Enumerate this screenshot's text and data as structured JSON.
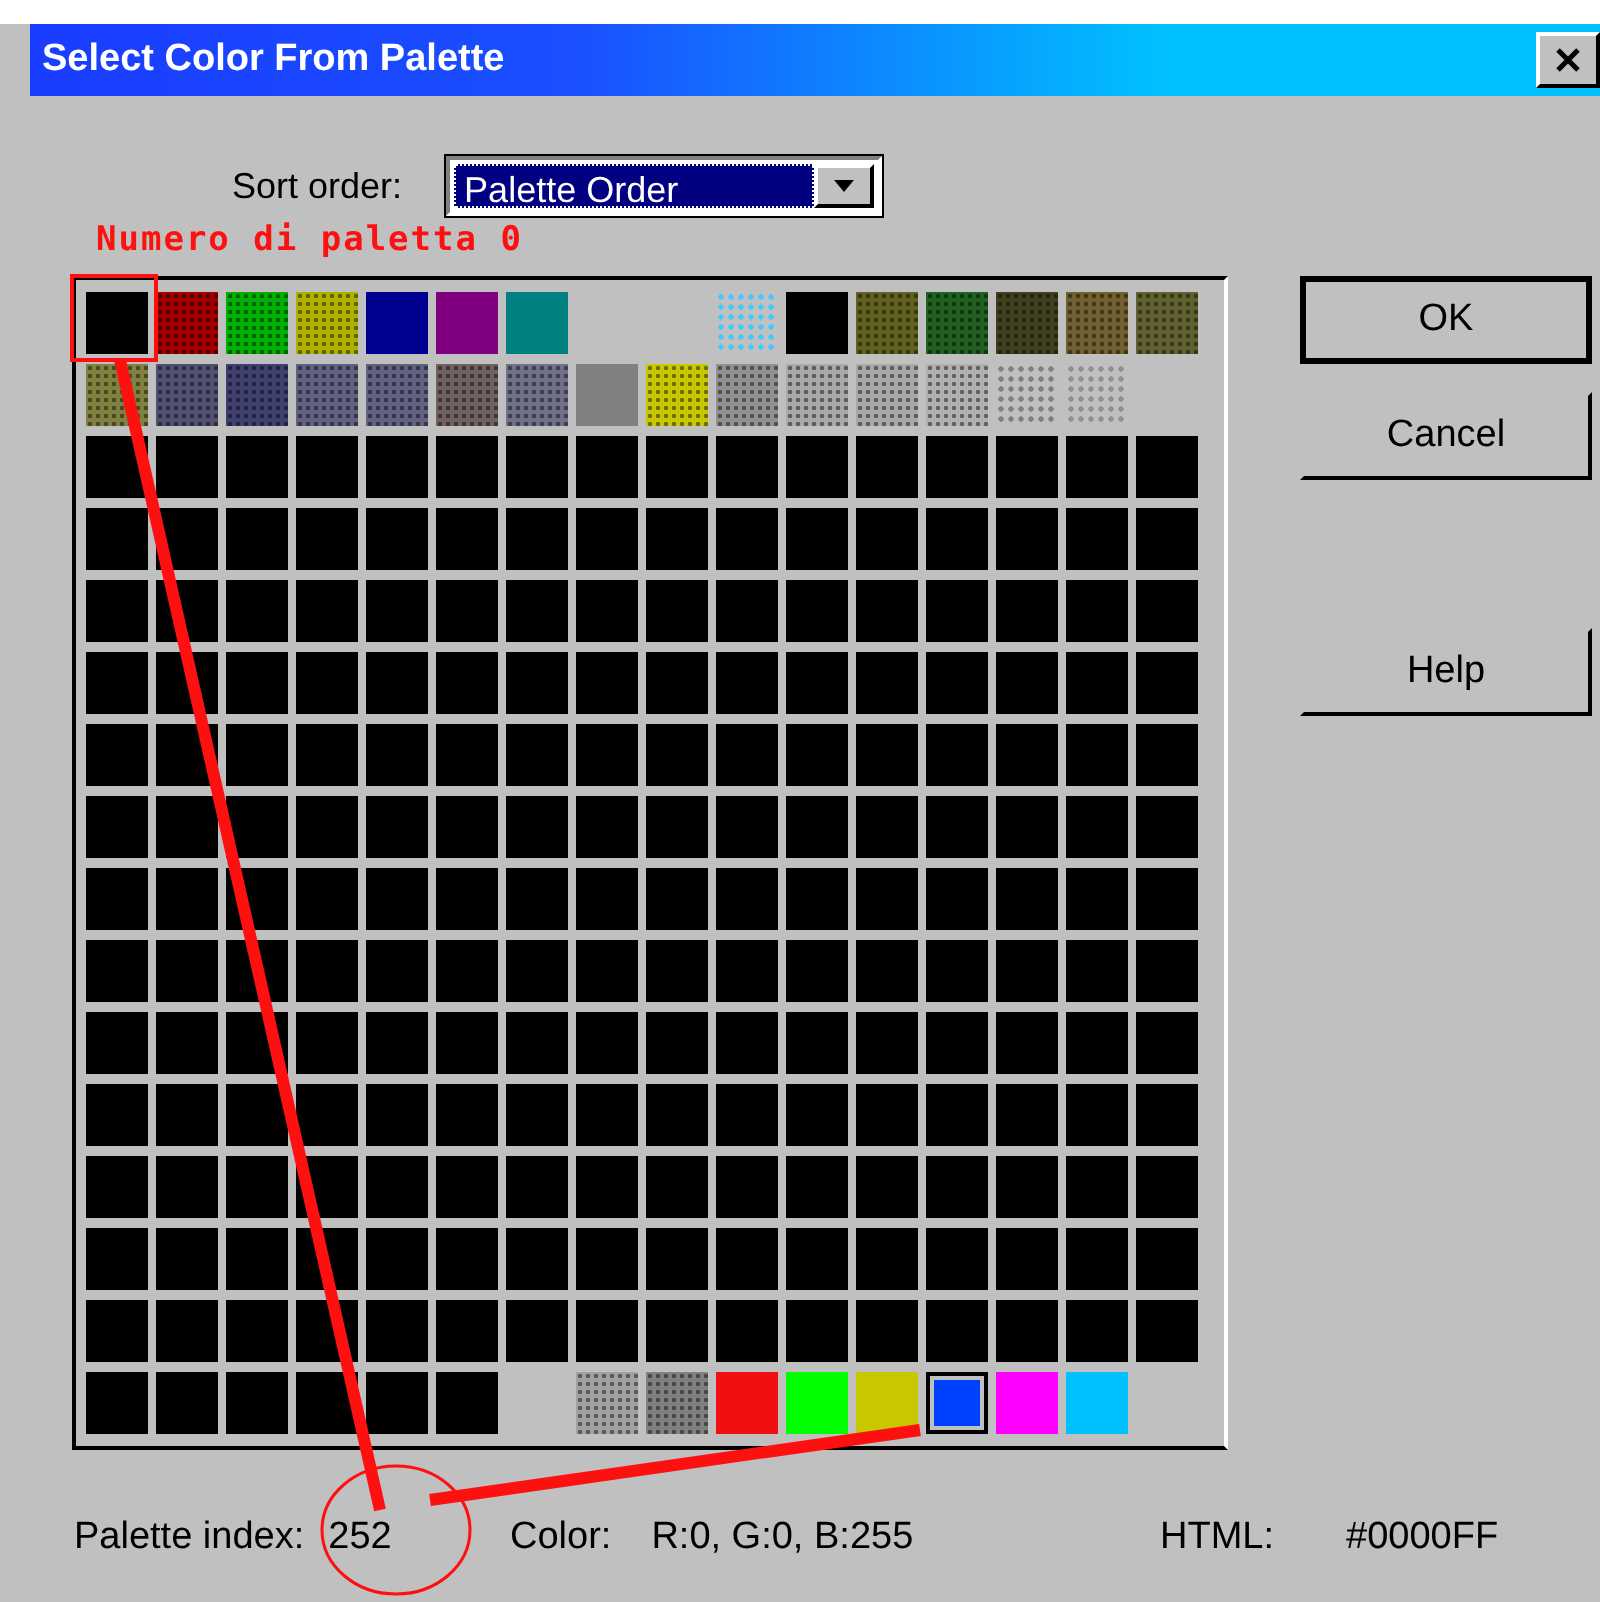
{
  "window": {
    "title": "Select Color From Palette"
  },
  "sort": {
    "label": "Sort order:",
    "value": "Palette Order"
  },
  "annotation": {
    "note": "Numero di paletta 0"
  },
  "palette": {
    "rows": [
      {
        "cells": [
          {
            "kind": "solid",
            "color": "#000000",
            "selected": false
          },
          {
            "kind": "dither",
            "color": "#a00000",
            "selected": false
          },
          {
            "kind": "dither",
            "color": "#00b000",
            "selected": false
          },
          {
            "kind": "dither",
            "color": "#b0b000",
            "selected": false
          },
          {
            "kind": "solid",
            "color": "#000090",
            "selected": false
          },
          {
            "kind": "solid",
            "color": "#800080",
            "selected": false
          },
          {
            "kind": "solid",
            "color": "#008080",
            "selected": false
          },
          {
            "kind": "empty"
          },
          {
            "kind": "empty"
          },
          {
            "kind": "dots",
            "color": "#40c8ff",
            "selected": false
          },
          {
            "kind": "solid",
            "color": "#000000",
            "selected": false
          },
          {
            "kind": "dither",
            "color": "#606020",
            "selected": false
          },
          {
            "kind": "dither",
            "color": "#206020",
            "selected": false
          },
          {
            "kind": "dither",
            "color": "#404020",
            "selected": false
          },
          {
            "kind": "dither",
            "color": "#706030",
            "selected": false
          },
          {
            "kind": "dither",
            "color": "#606030",
            "selected": false
          }
        ]
      },
      {
        "cells": [
          {
            "kind": "dither",
            "color": "#808040",
            "selected": false
          },
          {
            "kind": "dither",
            "color": "#505070",
            "selected": false
          },
          {
            "kind": "dither",
            "color": "#404070",
            "selected": false
          },
          {
            "kind": "dither",
            "color": "#606080",
            "selected": false
          },
          {
            "kind": "dither",
            "color": "#606080",
            "selected": false
          },
          {
            "kind": "dither",
            "color": "#706060",
            "selected": false
          },
          {
            "kind": "dither",
            "color": "#707088",
            "selected": false
          },
          {
            "kind": "solid",
            "color": "#808080",
            "selected": false
          },
          {
            "kind": "dither",
            "color": "#c8c800",
            "selected": false
          },
          {
            "kind": "dither",
            "color": "#909090",
            "selected": false
          },
          {
            "kind": "dither",
            "color": "#a8a8a8",
            "selected": false
          },
          {
            "kind": "dither",
            "color": "#a8a8a8",
            "selected": false
          },
          {
            "kind": "dither",
            "color": "#b0b0b0",
            "selected": false
          },
          {
            "kind": "dots",
            "color": "#808080",
            "selected": false
          },
          {
            "kind": "dots",
            "color": "#909090",
            "selected": false
          },
          {
            "kind": "empty"
          }
        ]
      },
      {
        "cells": [
          {
            "kind": "solid",
            "color": "#000000",
            "selected": false
          },
          {
            "kind": "solid",
            "color": "#000000",
            "selected": false
          },
          {
            "kind": "solid",
            "color": "#000000",
            "selected": false
          },
          {
            "kind": "solid",
            "color": "#000000",
            "selected": false
          },
          {
            "kind": "solid",
            "color": "#000000",
            "selected": false
          },
          {
            "kind": "solid",
            "color": "#000000",
            "selected": false
          },
          {
            "kind": "solid",
            "color": "#000000",
            "selected": false
          },
          {
            "kind": "solid",
            "color": "#000000",
            "selected": false
          },
          {
            "kind": "solid",
            "color": "#000000",
            "selected": false
          },
          {
            "kind": "solid",
            "color": "#000000",
            "selected": false
          },
          {
            "kind": "solid",
            "color": "#000000",
            "selected": false
          },
          {
            "kind": "solid",
            "color": "#000000",
            "selected": false
          },
          {
            "kind": "solid",
            "color": "#000000",
            "selected": false
          },
          {
            "kind": "solid",
            "color": "#000000",
            "selected": false
          },
          {
            "kind": "solid",
            "color": "#000000",
            "selected": false
          },
          {
            "kind": "solid",
            "color": "#000000",
            "selected": false
          }
        ]
      },
      {
        "cells": [
          {
            "kind": "solid",
            "color": "#000000",
            "selected": false
          },
          {
            "kind": "solid",
            "color": "#000000",
            "selected": false
          },
          {
            "kind": "solid",
            "color": "#000000",
            "selected": false
          },
          {
            "kind": "solid",
            "color": "#000000",
            "selected": false
          },
          {
            "kind": "solid",
            "color": "#000000",
            "selected": false
          },
          {
            "kind": "solid",
            "color": "#000000",
            "selected": false
          },
          {
            "kind": "solid",
            "color": "#000000",
            "selected": false
          },
          {
            "kind": "solid",
            "color": "#000000",
            "selected": false
          },
          {
            "kind": "solid",
            "color": "#000000",
            "selected": false
          },
          {
            "kind": "solid",
            "color": "#000000",
            "selected": false
          },
          {
            "kind": "solid",
            "color": "#000000",
            "selected": false
          },
          {
            "kind": "solid",
            "color": "#000000",
            "selected": false
          },
          {
            "kind": "solid",
            "color": "#000000",
            "selected": false
          },
          {
            "kind": "solid",
            "color": "#000000",
            "selected": false
          },
          {
            "kind": "solid",
            "color": "#000000",
            "selected": false
          },
          {
            "kind": "solid",
            "color": "#000000",
            "selected": false
          }
        ]
      },
      {
        "cells": [
          {
            "kind": "solid",
            "color": "#000000",
            "selected": false
          },
          {
            "kind": "solid",
            "color": "#000000",
            "selected": false
          },
          {
            "kind": "solid",
            "color": "#000000",
            "selected": false
          },
          {
            "kind": "solid",
            "color": "#000000",
            "selected": false
          },
          {
            "kind": "solid",
            "color": "#000000",
            "selected": false
          },
          {
            "kind": "solid",
            "color": "#000000",
            "selected": false
          },
          {
            "kind": "solid",
            "color": "#000000",
            "selected": false
          },
          {
            "kind": "solid",
            "color": "#000000",
            "selected": false
          },
          {
            "kind": "solid",
            "color": "#000000",
            "selected": false
          },
          {
            "kind": "solid",
            "color": "#000000",
            "selected": false
          },
          {
            "kind": "solid",
            "color": "#000000",
            "selected": false
          },
          {
            "kind": "solid",
            "color": "#000000",
            "selected": false
          },
          {
            "kind": "solid",
            "color": "#000000",
            "selected": false
          },
          {
            "kind": "solid",
            "color": "#000000",
            "selected": false
          },
          {
            "kind": "solid",
            "color": "#000000",
            "selected": false
          },
          {
            "kind": "solid",
            "color": "#000000",
            "selected": false
          }
        ]
      },
      {
        "cells": [
          {
            "kind": "solid",
            "color": "#000000",
            "selected": false
          },
          {
            "kind": "solid",
            "color": "#000000",
            "selected": false
          },
          {
            "kind": "solid",
            "color": "#000000",
            "selected": false
          },
          {
            "kind": "solid",
            "color": "#000000",
            "selected": false
          },
          {
            "kind": "solid",
            "color": "#000000",
            "selected": false
          },
          {
            "kind": "solid",
            "color": "#000000",
            "selected": false
          },
          {
            "kind": "solid",
            "color": "#000000",
            "selected": false
          },
          {
            "kind": "solid",
            "color": "#000000",
            "selected": false
          },
          {
            "kind": "solid",
            "color": "#000000",
            "selected": false
          },
          {
            "kind": "solid",
            "color": "#000000",
            "selected": false
          },
          {
            "kind": "solid",
            "color": "#000000",
            "selected": false
          },
          {
            "kind": "solid",
            "color": "#000000",
            "selected": false
          },
          {
            "kind": "solid",
            "color": "#000000",
            "selected": false
          },
          {
            "kind": "solid",
            "color": "#000000",
            "selected": false
          },
          {
            "kind": "solid",
            "color": "#000000",
            "selected": false
          },
          {
            "kind": "solid",
            "color": "#000000",
            "selected": false
          }
        ]
      },
      {
        "cells": [
          {
            "kind": "solid",
            "color": "#000000",
            "selected": false
          },
          {
            "kind": "solid",
            "color": "#000000",
            "selected": false
          },
          {
            "kind": "solid",
            "color": "#000000",
            "selected": false
          },
          {
            "kind": "solid",
            "color": "#000000",
            "selected": false
          },
          {
            "kind": "solid",
            "color": "#000000",
            "selected": false
          },
          {
            "kind": "solid",
            "color": "#000000",
            "selected": false
          },
          {
            "kind": "solid",
            "color": "#000000",
            "selected": false
          },
          {
            "kind": "solid",
            "color": "#000000",
            "selected": false
          },
          {
            "kind": "solid",
            "color": "#000000",
            "selected": false
          },
          {
            "kind": "solid",
            "color": "#000000",
            "selected": false
          },
          {
            "kind": "solid",
            "color": "#000000",
            "selected": false
          },
          {
            "kind": "solid",
            "color": "#000000",
            "selected": false
          },
          {
            "kind": "solid",
            "color": "#000000",
            "selected": false
          },
          {
            "kind": "solid",
            "color": "#000000",
            "selected": false
          },
          {
            "kind": "solid",
            "color": "#000000",
            "selected": false
          },
          {
            "kind": "solid",
            "color": "#000000",
            "selected": false
          }
        ]
      },
      {
        "cells": [
          {
            "kind": "solid",
            "color": "#000000",
            "selected": false
          },
          {
            "kind": "solid",
            "color": "#000000",
            "selected": false
          },
          {
            "kind": "solid",
            "color": "#000000",
            "selected": false
          },
          {
            "kind": "solid",
            "color": "#000000",
            "selected": false
          },
          {
            "kind": "solid",
            "color": "#000000",
            "selected": false
          },
          {
            "kind": "solid",
            "color": "#000000",
            "selected": false
          },
          {
            "kind": "solid",
            "color": "#000000",
            "selected": false
          },
          {
            "kind": "solid",
            "color": "#000000",
            "selected": false
          },
          {
            "kind": "solid",
            "color": "#000000",
            "selected": false
          },
          {
            "kind": "solid",
            "color": "#000000",
            "selected": false
          },
          {
            "kind": "solid",
            "color": "#000000",
            "selected": false
          },
          {
            "kind": "solid",
            "color": "#000000",
            "selected": false
          },
          {
            "kind": "solid",
            "color": "#000000",
            "selected": false
          },
          {
            "kind": "solid",
            "color": "#000000",
            "selected": false
          },
          {
            "kind": "solid",
            "color": "#000000",
            "selected": false
          },
          {
            "kind": "solid",
            "color": "#000000",
            "selected": false
          }
        ]
      },
      {
        "cells": [
          {
            "kind": "solid",
            "color": "#000000",
            "selected": false
          },
          {
            "kind": "solid",
            "color": "#000000",
            "selected": false
          },
          {
            "kind": "solid",
            "color": "#000000",
            "selected": false
          },
          {
            "kind": "solid",
            "color": "#000000",
            "selected": false
          },
          {
            "kind": "solid",
            "color": "#000000",
            "selected": false
          },
          {
            "kind": "solid",
            "color": "#000000",
            "selected": false
          },
          {
            "kind": "solid",
            "color": "#000000",
            "selected": false
          },
          {
            "kind": "solid",
            "color": "#000000",
            "selected": false
          },
          {
            "kind": "solid",
            "color": "#000000",
            "selected": false
          },
          {
            "kind": "solid",
            "color": "#000000",
            "selected": false
          },
          {
            "kind": "solid",
            "color": "#000000",
            "selected": false
          },
          {
            "kind": "solid",
            "color": "#000000",
            "selected": false
          },
          {
            "kind": "solid",
            "color": "#000000",
            "selected": false
          },
          {
            "kind": "solid",
            "color": "#000000",
            "selected": false
          },
          {
            "kind": "solid",
            "color": "#000000",
            "selected": false
          },
          {
            "kind": "solid",
            "color": "#000000",
            "selected": false
          }
        ]
      },
      {
        "cells": [
          {
            "kind": "solid",
            "color": "#000000",
            "selected": false
          },
          {
            "kind": "solid",
            "color": "#000000",
            "selected": false
          },
          {
            "kind": "solid",
            "color": "#000000",
            "selected": false
          },
          {
            "kind": "solid",
            "color": "#000000",
            "selected": false
          },
          {
            "kind": "solid",
            "color": "#000000",
            "selected": false
          },
          {
            "kind": "solid",
            "color": "#000000",
            "selected": false
          },
          {
            "kind": "solid",
            "color": "#000000",
            "selected": false
          },
          {
            "kind": "solid",
            "color": "#000000",
            "selected": false
          },
          {
            "kind": "solid",
            "color": "#000000",
            "selected": false
          },
          {
            "kind": "solid",
            "color": "#000000",
            "selected": false
          },
          {
            "kind": "solid",
            "color": "#000000",
            "selected": false
          },
          {
            "kind": "solid",
            "color": "#000000",
            "selected": false
          },
          {
            "kind": "solid",
            "color": "#000000",
            "selected": false
          },
          {
            "kind": "solid",
            "color": "#000000",
            "selected": false
          },
          {
            "kind": "solid",
            "color": "#000000",
            "selected": false
          },
          {
            "kind": "solid",
            "color": "#000000",
            "selected": false
          }
        ]
      },
      {
        "cells": [
          {
            "kind": "solid",
            "color": "#000000",
            "selected": false
          },
          {
            "kind": "solid",
            "color": "#000000",
            "selected": false
          },
          {
            "kind": "solid",
            "color": "#000000",
            "selected": false
          },
          {
            "kind": "solid",
            "color": "#000000",
            "selected": false
          },
          {
            "kind": "solid",
            "color": "#000000",
            "selected": false
          },
          {
            "kind": "solid",
            "color": "#000000",
            "selected": false
          },
          {
            "kind": "solid",
            "color": "#000000",
            "selected": false
          },
          {
            "kind": "solid",
            "color": "#000000",
            "selected": false
          },
          {
            "kind": "solid",
            "color": "#000000",
            "selected": false
          },
          {
            "kind": "solid",
            "color": "#000000",
            "selected": false
          },
          {
            "kind": "solid",
            "color": "#000000",
            "selected": false
          },
          {
            "kind": "solid",
            "color": "#000000",
            "selected": false
          },
          {
            "kind": "solid",
            "color": "#000000",
            "selected": false
          },
          {
            "kind": "solid",
            "color": "#000000",
            "selected": false
          },
          {
            "kind": "solid",
            "color": "#000000",
            "selected": false
          },
          {
            "kind": "solid",
            "color": "#000000",
            "selected": false
          }
        ]
      },
      {
        "cells": [
          {
            "kind": "solid",
            "color": "#000000",
            "selected": false
          },
          {
            "kind": "solid",
            "color": "#000000",
            "selected": false
          },
          {
            "kind": "solid",
            "color": "#000000",
            "selected": false
          },
          {
            "kind": "solid",
            "color": "#000000",
            "selected": false
          },
          {
            "kind": "solid",
            "color": "#000000",
            "selected": false
          },
          {
            "kind": "solid",
            "color": "#000000",
            "selected": false
          },
          {
            "kind": "solid",
            "color": "#000000",
            "selected": false
          },
          {
            "kind": "solid",
            "color": "#000000",
            "selected": false
          },
          {
            "kind": "solid",
            "color": "#000000",
            "selected": false
          },
          {
            "kind": "solid",
            "color": "#000000",
            "selected": false
          },
          {
            "kind": "solid",
            "color": "#000000",
            "selected": false
          },
          {
            "kind": "solid",
            "color": "#000000",
            "selected": false
          },
          {
            "kind": "solid",
            "color": "#000000",
            "selected": false
          },
          {
            "kind": "solid",
            "color": "#000000",
            "selected": false
          },
          {
            "kind": "solid",
            "color": "#000000",
            "selected": false
          },
          {
            "kind": "solid",
            "color": "#000000",
            "selected": false
          }
        ]
      },
      {
        "cells": [
          {
            "kind": "solid",
            "color": "#000000",
            "selected": false
          },
          {
            "kind": "solid",
            "color": "#000000",
            "selected": false
          },
          {
            "kind": "solid",
            "color": "#000000",
            "selected": false
          },
          {
            "kind": "solid",
            "color": "#000000",
            "selected": false
          },
          {
            "kind": "solid",
            "color": "#000000",
            "selected": false
          },
          {
            "kind": "solid",
            "color": "#000000",
            "selected": false
          },
          {
            "kind": "solid",
            "color": "#000000",
            "selected": false
          },
          {
            "kind": "solid",
            "color": "#000000",
            "selected": false
          },
          {
            "kind": "solid",
            "color": "#000000",
            "selected": false
          },
          {
            "kind": "solid",
            "color": "#000000",
            "selected": false
          },
          {
            "kind": "solid",
            "color": "#000000",
            "selected": false
          },
          {
            "kind": "solid",
            "color": "#000000",
            "selected": false
          },
          {
            "kind": "solid",
            "color": "#000000",
            "selected": false
          },
          {
            "kind": "solid",
            "color": "#000000",
            "selected": false
          },
          {
            "kind": "solid",
            "color": "#000000",
            "selected": false
          },
          {
            "kind": "solid",
            "color": "#000000",
            "selected": false
          }
        ]
      },
      {
        "cells": [
          {
            "kind": "solid",
            "color": "#000000",
            "selected": false
          },
          {
            "kind": "solid",
            "color": "#000000",
            "selected": false
          },
          {
            "kind": "solid",
            "color": "#000000",
            "selected": false
          },
          {
            "kind": "solid",
            "color": "#000000",
            "selected": false
          },
          {
            "kind": "solid",
            "color": "#000000",
            "selected": false
          },
          {
            "kind": "solid",
            "color": "#000000",
            "selected": false
          },
          {
            "kind": "solid",
            "color": "#000000",
            "selected": false
          },
          {
            "kind": "solid",
            "color": "#000000",
            "selected": false
          },
          {
            "kind": "solid",
            "color": "#000000",
            "selected": false
          },
          {
            "kind": "solid",
            "color": "#000000",
            "selected": false
          },
          {
            "kind": "solid",
            "color": "#000000",
            "selected": false
          },
          {
            "kind": "solid",
            "color": "#000000",
            "selected": false
          },
          {
            "kind": "solid",
            "color": "#000000",
            "selected": false
          },
          {
            "kind": "solid",
            "color": "#000000",
            "selected": false
          },
          {
            "kind": "solid",
            "color": "#000000",
            "selected": false
          },
          {
            "kind": "solid",
            "color": "#000000",
            "selected": false
          }
        ]
      },
      {
        "cells": [
          {
            "kind": "solid",
            "color": "#000000",
            "selected": false
          },
          {
            "kind": "solid",
            "color": "#000000",
            "selected": false
          },
          {
            "kind": "solid",
            "color": "#000000",
            "selected": false
          },
          {
            "kind": "solid",
            "color": "#000000",
            "selected": false
          },
          {
            "kind": "solid",
            "color": "#000000",
            "selected": false
          },
          {
            "kind": "solid",
            "color": "#000000",
            "selected": false
          },
          {
            "kind": "solid",
            "color": "#000000",
            "selected": false
          },
          {
            "kind": "solid",
            "color": "#000000",
            "selected": false
          },
          {
            "kind": "solid",
            "color": "#000000",
            "selected": false
          },
          {
            "kind": "solid",
            "color": "#000000",
            "selected": false
          },
          {
            "kind": "solid",
            "color": "#000000",
            "selected": false
          },
          {
            "kind": "solid",
            "color": "#000000",
            "selected": false
          },
          {
            "kind": "solid",
            "color": "#000000",
            "selected": false
          },
          {
            "kind": "solid",
            "color": "#000000",
            "selected": false
          },
          {
            "kind": "solid",
            "color": "#000000",
            "selected": false
          },
          {
            "kind": "solid",
            "color": "#000000",
            "selected": false
          }
        ]
      },
      {
        "cells": [
          {
            "kind": "solid",
            "color": "#000000",
            "selected": false
          },
          {
            "kind": "solid",
            "color": "#000000",
            "selected": false
          },
          {
            "kind": "solid",
            "color": "#000000",
            "selected": false
          },
          {
            "kind": "solid",
            "color": "#000000",
            "selected": false
          },
          {
            "kind": "solid",
            "color": "#000000",
            "selected": false
          },
          {
            "kind": "solid",
            "color": "#000000",
            "selected": false
          },
          {
            "kind": "empty"
          },
          {
            "kind": "dither",
            "color": "#a0a0a0",
            "selected": false
          },
          {
            "kind": "dither",
            "color": "#808080",
            "selected": false
          },
          {
            "kind": "solid",
            "color": "#f01010",
            "selected": false
          },
          {
            "kind": "solid",
            "color": "#00ff00",
            "selected": false
          },
          {
            "kind": "solid",
            "color": "#c8c800",
            "selected": false
          },
          {
            "kind": "solid",
            "color": "#0040ff",
            "selected": true
          },
          {
            "kind": "solid",
            "color": "#ff00ff",
            "selected": false
          },
          {
            "kind": "solid",
            "color": "#00c0ff",
            "selected": false
          },
          {
            "kind": "empty"
          }
        ]
      }
    ]
  },
  "buttons": [
    {
      "label": "OK",
      "default": true
    },
    {
      "label": "Cancel",
      "default": false
    },
    {
      "label": "Help",
      "default": false
    }
  ],
  "status": [
    {
      "label": "Palette index:",
      "value": "252"
    },
    {
      "label": "Color:",
      "value": "R:0, G:0, B:255"
    },
    {
      "label": "HTML:",
      "value": "#0000FF"
    }
  ]
}
